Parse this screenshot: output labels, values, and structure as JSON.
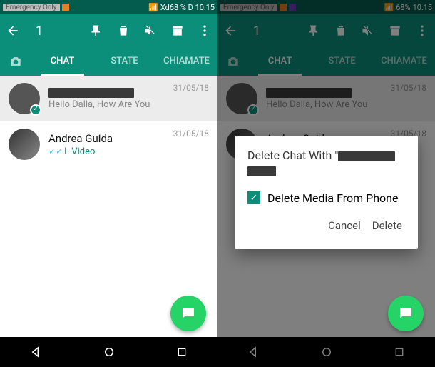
{
  "statusbar": {
    "emergency": "Emergency Only",
    "center": "Xd68 % D 10:15",
    "battery": "68%",
    "time": "10:15"
  },
  "toolbar": {
    "selected_count": "1"
  },
  "tabs": {
    "chat": "CHAT",
    "state": "STATE",
    "calls": "CHIAMATE"
  },
  "chats": [
    {
      "name_redacted": true,
      "preview": "Hello Dalla, How Are You",
      "date": "31/05/18",
      "selected": true
    },
    {
      "name": "Andrea Guida",
      "preview": "L Video",
      "date": "31/05/18",
      "ticks": true
    }
  ],
  "dialog": {
    "title_prefix": "Delete Chat With \"",
    "checkbox_label": "Delete Media From Phone",
    "cancel": "Cancel",
    "delete": "Delete"
  }
}
